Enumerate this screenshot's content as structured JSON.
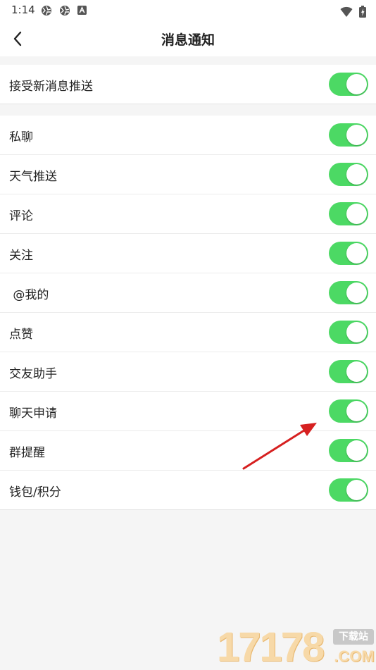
{
  "status_bar": {
    "time": "1:14",
    "left_icons": [
      "aperture-icon",
      "aperture-icon",
      "app-a-icon"
    ],
    "right_icons": [
      "wifi-icon",
      "battery-charging-icon"
    ]
  },
  "header": {
    "title": "消息通知",
    "back_icon": "chevron-left-icon"
  },
  "section_main": {
    "items": [
      {
        "label": "接受新消息推送",
        "enabled": true
      }
    ]
  },
  "section_types": {
    "items": [
      {
        "label": "私聊",
        "enabled": true
      },
      {
        "label": "天气推送",
        "enabled": true
      },
      {
        "label": "评论",
        "enabled": true
      },
      {
        "label": "关注",
        "enabled": true
      },
      {
        "label": " @我的",
        "enabled": true
      },
      {
        "label": "点赞",
        "enabled": true
      },
      {
        "label": "交友助手",
        "enabled": true
      },
      {
        "label": "聊天申请",
        "enabled": true
      },
      {
        "label": "群提醒",
        "enabled": true
      },
      {
        "label": "钱包/积分",
        "enabled": true
      }
    ]
  },
  "colors": {
    "toggle_on": "#4cd964",
    "background": "#f5f5f5",
    "annotation_arrow": "#d62020"
  },
  "watermark": {
    "digits": "17178",
    "badge": "下载站",
    "domain": ".COM"
  }
}
